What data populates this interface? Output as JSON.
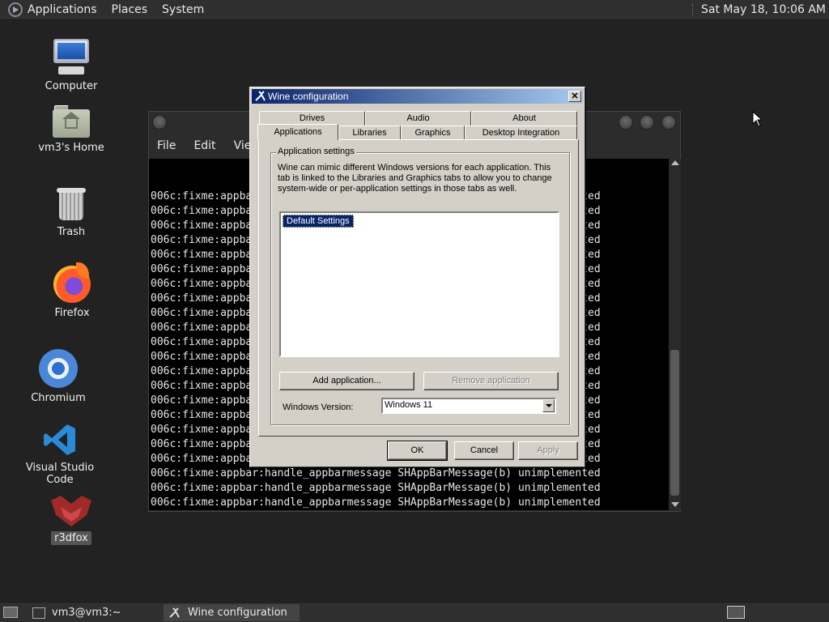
{
  "top_panel": {
    "menus": [
      "Applications",
      "Places",
      "System"
    ],
    "clock": "Sat May 18, 10:06 AM"
  },
  "desktop": {
    "icons": [
      {
        "name": "computer",
        "label": "Computer"
      },
      {
        "name": "home",
        "label": "vm3's Home"
      },
      {
        "name": "trash",
        "label": "Trash"
      },
      {
        "name": "firefox",
        "label": "Firefox"
      },
      {
        "name": "chromium",
        "label": "Chromium"
      },
      {
        "name": "vscode",
        "label": "Visual Studio Code"
      },
      {
        "name": "r3dfox",
        "label": "r3dfox"
      }
    ]
  },
  "terminal": {
    "menu": [
      "File",
      "Edit",
      "View"
    ],
    "lines": [
      "006c:fixme:appbar:handle_appbarmessage SHAppBarMessage(b) unimplemented",
      "006c:fixme:appbar:handle_appbarmessage SHAppBarMessage(b) unimplemented",
      "006c:fixme:appbar:handle_appbarmessage SHAppBarMessage(b) unimplemented",
      "006c:fixme:appbar:handle_appbarmessage SHAppBarMessage(b) unimplemented",
      "006c:fixme:appbar:handle_appbarmessage SHAppBarMessage(b) unimplemented",
      "006c:fixme:appbar:handle_appbarmessage SHAppBarMessage(b) unimplemented",
      "006c:fixme:appbar:handle_appbarmessage SHAppBarMessage(b) unimplemented",
      "006c:fixme:appbar:handle_appbarmessage SHAppBarMessage(b) unimplemented",
      "006c:fixme:appbar:handle_appbarmessage SHAppBarMessage(b) unimplemented",
      "006c:fixme:appbar:handle_appbarmessage SHAppBarMessage(b) unimplemented",
      "006c:fixme:appbar:handle_appbarmessage SHAppBarMessage(b) unimplemented",
      "006c:fixme:appbar:handle_appbarmessage SHAppBarMessage(b) unimplemented",
      "006c:fixme:appbar:handle_appbarmessage SHAppBarMessage(b) unimplemented",
      "006c:fixme:appbar:handle_appbarmessage SHAppBarMessage(b) unimplemented",
      "006c:fixme:appbar:handle_appbarmessage SHAppBarMessage(b) unimplemented",
      "006c:fixme:appbar:handle_appbarmessage SHAppBarMessage(b) unimplemented",
      "006c:fixme:appbar:handle_appbarmessage SHAppBarMessage(b) unimplemented",
      "006c:fixme:appbar:handle_appbarmessage SHAppBarMessage(b) unimplemented",
      "006c:fixme:appbar:handle_appbarmessage SHAppBarMessage(b) unimplemented",
      "006c:fixme:appbar:handle_appbarmessage SHAppBarMessage(b) unimplemented",
      "006c:fixme:appbar:handle_appbarmessage SHAppBarMessage(b) unimplemented",
      "006c:fixme:appbar:handle_appbarmessage SHAppBarMessage(b) unimplemented",
      "006c:fixme:appbar:handle_appbarmessage SHAppBarMessage(b) unimplemented"
    ]
  },
  "wine": {
    "title": "Wine configuration",
    "close": "✕",
    "tabs_back": [
      "Drives",
      "Audio",
      "About"
    ],
    "tabs_front": [
      "Applications",
      "Libraries",
      "Graphics",
      "Desktop Integration"
    ],
    "group_label": "Application settings",
    "description": "Wine can mimic different Windows versions for each application. This tab is linked to the Libraries and Graphics tabs to allow you to change system-wide or per-application settings in those tabs as well.",
    "list_items": [
      "Default Settings"
    ],
    "add_button": "Add application...",
    "remove_button": "Remove application",
    "version_label": "Windows Version:",
    "version_value": "Windows 11",
    "ok": "OK",
    "cancel": "Cancel",
    "apply": "Apply"
  },
  "bottom_panel": {
    "tasks": [
      "vm3@vm3:~",
      "Wine configuration"
    ]
  }
}
